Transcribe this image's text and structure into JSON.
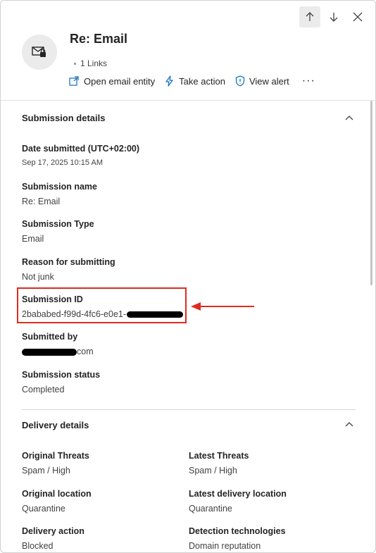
{
  "nav": {
    "up_icon": "arrow-up-icon",
    "down_icon": "arrow-down-icon",
    "close_icon": "close-icon"
  },
  "header": {
    "title": "Re: Email",
    "links": "1 Links",
    "actions": {
      "open_email_entity": "Open email entity",
      "take_action": "Take action",
      "view_alert": "View alert",
      "more": "···"
    }
  },
  "submission": {
    "section_title": "Submission details",
    "fields": {
      "date_label": "Date submitted (UTC+02:00)",
      "date_value": "Sep 17, 2025 10:15 AM",
      "name_label": "Submission name",
      "name_value": "Re: Email",
      "type_label": "Submission Type",
      "type_value": "Email",
      "reason_label": "Reason for submitting",
      "reason_value": "Not junk",
      "id_label": "Submission ID",
      "id_value": "2bababed-f99d-4fc6-e0e1-",
      "by_label": "Submitted by",
      "by_value_suffix": "com",
      "status_label": "Submission status",
      "status_value": "Completed"
    }
  },
  "delivery": {
    "section_title": "Delivery details",
    "original_threats_label": "Original Threats",
    "original_threats_value": "Spam / High",
    "latest_threats_label": "Latest Threats",
    "latest_threats_value": "Spam / High",
    "original_location_label": "Original location",
    "original_location_value": "Quarantine",
    "latest_location_label": "Latest delivery location",
    "latest_location_value": "Quarantine",
    "delivery_action_label": "Delivery action",
    "delivery_action_value": "Blocked",
    "detection_label": "Detection technologies",
    "detection_value": "Domain reputation"
  },
  "colors": {
    "annotation_red": "#e02b20",
    "text": "#242424",
    "muted": "#424242",
    "accent": "#0f6cbd"
  }
}
